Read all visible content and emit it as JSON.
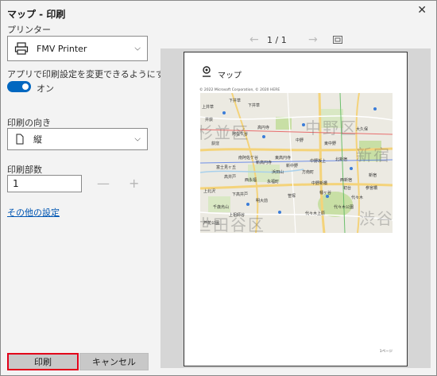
{
  "window": {
    "title": "マップ - 印刷"
  },
  "printer": {
    "label": "プリンター",
    "selected": "FMV Printer"
  },
  "app_settings": {
    "label": "アプリで印刷設定を変更できるようにする",
    "toggle_state": "オン"
  },
  "orientation": {
    "label": "印刷の向き",
    "selected": "縦"
  },
  "copies": {
    "label": "印刷部数",
    "value": "1",
    "minus": "—",
    "plus": "+"
  },
  "more_settings": "その他の設定",
  "buttons": {
    "print": "印刷",
    "cancel": "キャンセル"
  },
  "preview": {
    "page_counter": "1 / 1",
    "map_title": "マップ",
    "copyright": "© 2022 Microsoft Corporation, © 2020 HERE",
    "footer": "1ページ",
    "map_labels": [
      "下井草",
      "下井草",
      "荻窪",
      "高円寺",
      "中野",
      "東中野",
      "新宿",
      "西新宿",
      "方南町",
      "代々木上原",
      "代々木",
      "幡ヶ谷",
      "笹塚",
      "明大前",
      "永福町",
      "上北沢",
      "下高井戸",
      "千歳烏山",
      "芦花公園",
      "上祖師谷",
      "西永福",
      "浜田山",
      "高井戸",
      "富士見ヶ丘",
      "阿佐ケ谷",
      "中野坂上",
      "中野新橋",
      "新中野",
      "東高円寺",
      "新高円寺",
      "南阿佐ケ谷",
      "初台",
      "参宮橋",
      "大久保",
      "代々木公園",
      "北新宿",
      "井荻",
      "上井草",
      "杉並区",
      "中野区",
      "新宿区",
      "渋谷区",
      "世田谷区"
    ]
  },
  "colors": {
    "accent": "#0067c0",
    "highlight": "#e2001a",
    "button": "#c8c8c8",
    "map_park": "#c8dfa5",
    "map_road": "#f4d37a",
    "map_water": "#a8d0ec"
  }
}
